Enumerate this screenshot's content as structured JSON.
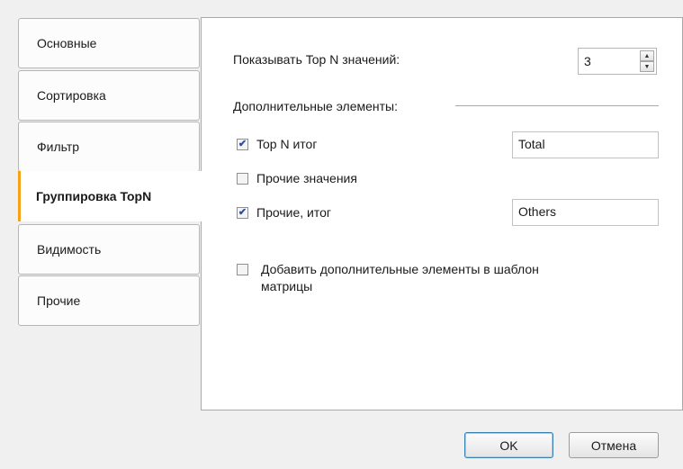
{
  "tabs": [
    {
      "label": "Основные"
    },
    {
      "label": "Сортировка"
    },
    {
      "label": "Фильтр"
    },
    {
      "label": "Группировка TopN"
    },
    {
      "label": "Видимость"
    },
    {
      "label": "Прочие"
    }
  ],
  "active_tab": "Группировка TopN",
  "panel": {
    "show_topn_label": "Показывать Top N значений:",
    "show_topn_value": "3",
    "extra_section_label": "Дополнительные элементы:",
    "topn_total": {
      "label": "Top N итог",
      "checked": true,
      "value": "Total"
    },
    "other_values": {
      "label": "Прочие значения",
      "checked": false
    },
    "other_total": {
      "label": "Прочие, итог",
      "checked": true,
      "value": "Others"
    },
    "add_to_template": {
      "line1": "Добавить дополнительные элементы в шаблон",
      "line2": "матрицы",
      "checked": false
    }
  },
  "buttons": {
    "ok": "OK",
    "cancel": "Отмена"
  },
  "colors": {
    "active_tab_accent": "#f7a117",
    "checkmark": "#2a4f9e",
    "default_button_border": "#3c7fb1"
  }
}
